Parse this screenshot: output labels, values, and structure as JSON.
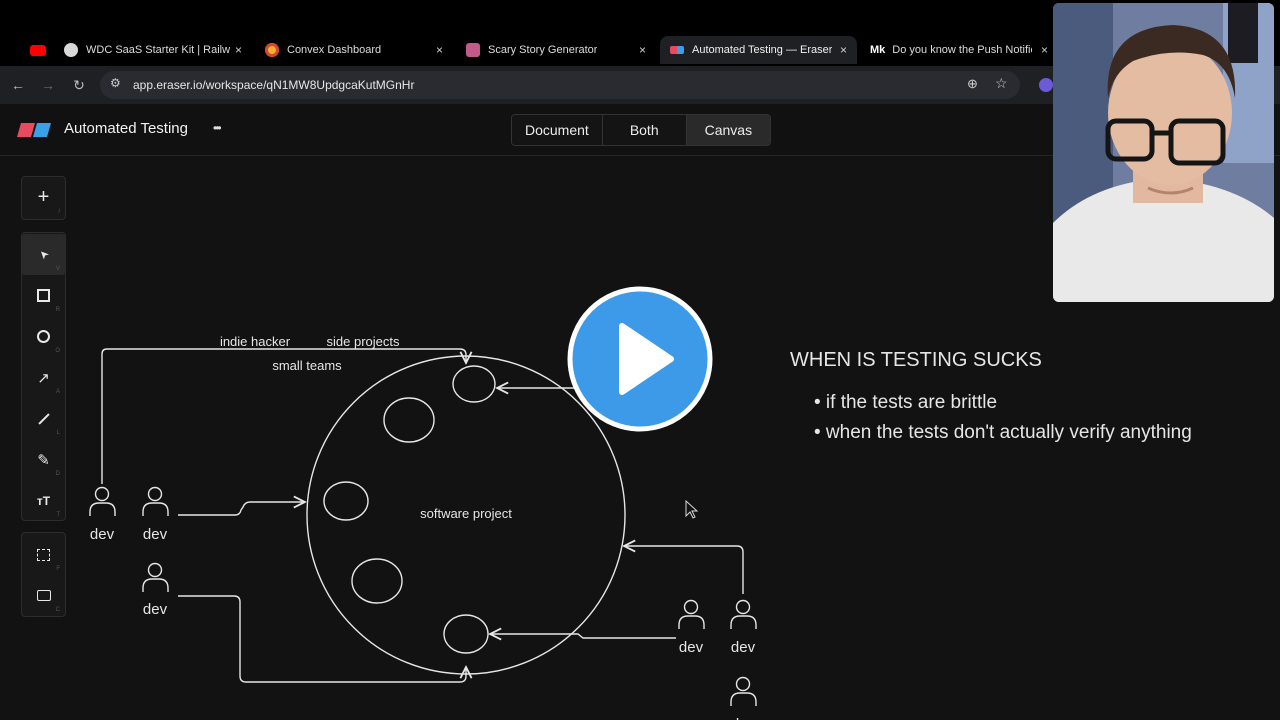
{
  "browser": {
    "tabs": [
      {
        "title": "",
        "color": "#ff0000"
      },
      {
        "title": "WDC SaaS Starter Kit | Railw",
        "color": "#e0e0e0"
      },
      {
        "title": "Convex Dashboard",
        "color": "#f2b134"
      },
      {
        "title": "Scary Story Generator",
        "color": "#c45a8a"
      },
      {
        "title": "Automated Testing — Eraser",
        "color": "#e84a5f"
      },
      {
        "title": "Do you know the Push Notific",
        "color": "#ffffff"
      }
    ],
    "close_glyph": "×",
    "url": "app.eraser.io/workspace/qN1MW8UpdgcaKutMGnHr",
    "medium_logo": "Mk"
  },
  "app": {
    "title": "Automated Testing",
    "more_glyph": "•••",
    "view_modes": [
      "Document",
      "Both",
      "Canvas"
    ]
  },
  "toolbar": {
    "tools": [
      {
        "name": "select",
        "glyph": "➤",
        "key": "V"
      },
      {
        "name": "rectangle",
        "glyph": "□",
        "key": "R"
      },
      {
        "name": "ellipse",
        "glyph": "○",
        "key": "O"
      },
      {
        "name": "arrow",
        "glyph": "↗",
        "key": "A"
      },
      {
        "name": "line",
        "glyph": "╱",
        "key": "L"
      },
      {
        "name": "pen",
        "glyph": "✎",
        "key": "D"
      },
      {
        "name": "text",
        "glyph": "тT",
        "key": "T"
      }
    ],
    "add": {
      "glyph": "+",
      "key": "/"
    },
    "frame": {
      "glyph": "⬚",
      "key": "F"
    },
    "comment": {
      "glyph": "▭",
      "key": "C"
    }
  },
  "diagram": {
    "label_indie": "indie hacker",
    "label_side": "side projects",
    "label_small": "small teams",
    "center_label": "software project",
    "dev_label": "dev"
  },
  "notes": {
    "heading": "WHEN IS TESTING SUCKS",
    "bullets": [
      "• if the tests are brittle",
      "• when the tests don't actually verify anything"
    ]
  },
  "colors": {
    "canvas_bg": "#121212",
    "stroke": "#e6e6e6",
    "play_blue": "#3d9ae8"
  }
}
